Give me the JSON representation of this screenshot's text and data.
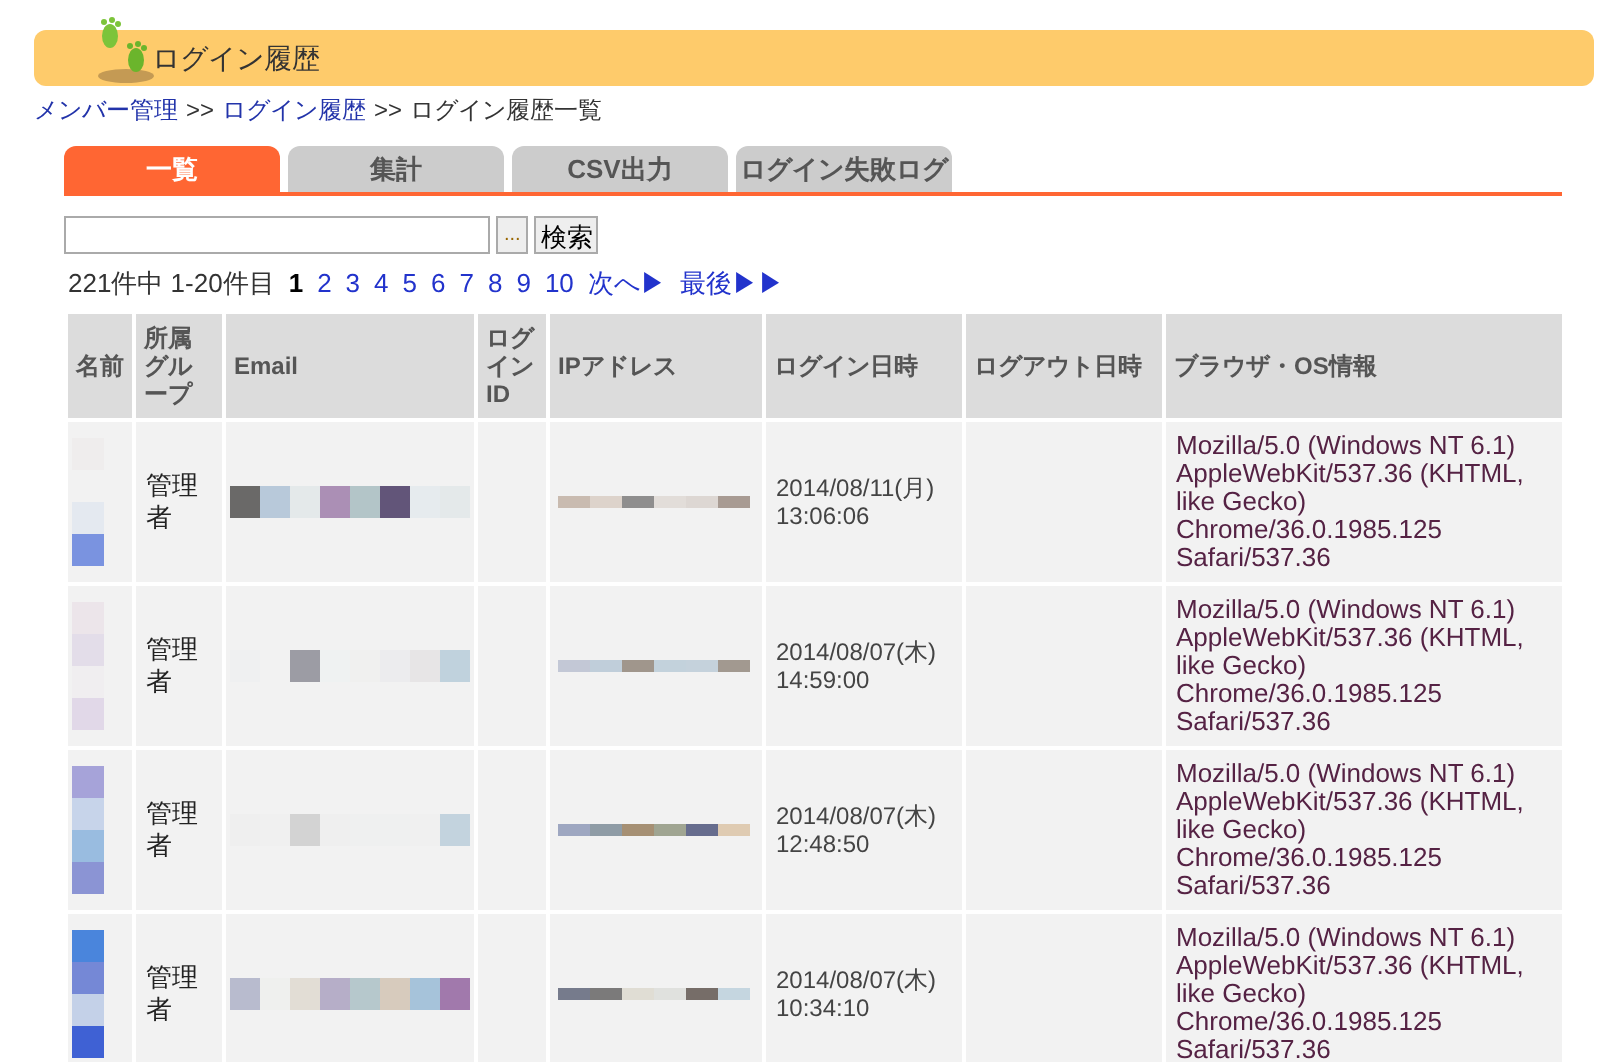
{
  "header": {
    "title": "ログイン履歴"
  },
  "breadcrumb": [
    {
      "label": "メンバー管理",
      "link": true
    },
    {
      "label": ">>",
      "link": false
    },
    {
      "label": "ログイン履歴",
      "link": true
    },
    {
      "label": ">>",
      "link": false
    },
    {
      "label": "ログイン履歴一覧",
      "link": false
    }
  ],
  "tabs": [
    {
      "label": "一覧",
      "selected": true
    },
    {
      "label": "集計",
      "selected": false
    },
    {
      "label": "CSV出力",
      "selected": false
    },
    {
      "label": "ログイン失敗ログ",
      "selected": false
    }
  ],
  "search": {
    "browse_button": "...",
    "submit_button": "検索"
  },
  "pagination": {
    "summary": "221件中 1-20件目",
    "pages": [
      {
        "label": "1",
        "selected": true
      },
      {
        "label": "2",
        "selected": false
      },
      {
        "label": "3",
        "selected": false
      },
      {
        "label": "4",
        "selected": false
      },
      {
        "label": "5",
        "selected": false
      },
      {
        "label": "6",
        "selected": false
      },
      {
        "label": "7",
        "selected": false
      },
      {
        "label": "8",
        "selected": false
      },
      {
        "label": "9",
        "selected": false
      },
      {
        "label": "10",
        "selected": false
      }
    ],
    "next": "次へ▶",
    "last": "最後▶▶"
  },
  "table": {
    "columns": [
      "名前",
      "所属グループ",
      "Email",
      "ログインID",
      "IPアドレス",
      "ログイン日時",
      "ログアウト日時",
      "ブラウザ・OS情報"
    ],
    "rows": [
      {
        "group": "管理者",
        "login_date": "2014/08/11(月)",
        "login_time": "13:06:06",
        "browser": "Mozilla/5.0 (Windows NT 6.1) AppleWebKit/537.36 (KHTML, like Gecko) Chrome/36.0.1985.125 Safari/537.36"
      },
      {
        "group": "管理者",
        "login_date": "2014/08/07(木)",
        "login_time": "14:59:00",
        "browser": "Mozilla/5.0 (Windows NT 6.1) AppleWebKit/537.36 (KHTML, like Gecko) Chrome/36.0.1985.125 Safari/537.36"
      },
      {
        "group": "管理者",
        "login_date": "2014/08/07(木)",
        "login_time": "12:48:50",
        "browser": "Mozilla/5.0 (Windows NT 6.1) AppleWebKit/537.36 (KHTML, like Gecko) Chrome/36.0.1985.125 Safari/537.36"
      },
      {
        "group": "管理者",
        "login_date": "2014/08/07(木)",
        "login_time": "10:34:10",
        "browser": "Mozilla/5.0 (Windows NT 6.1) AppleWebKit/537.36 (KHTML, like Gecko) Chrome/36.0.1985.125 Safari/537.36"
      }
    ]
  }
}
